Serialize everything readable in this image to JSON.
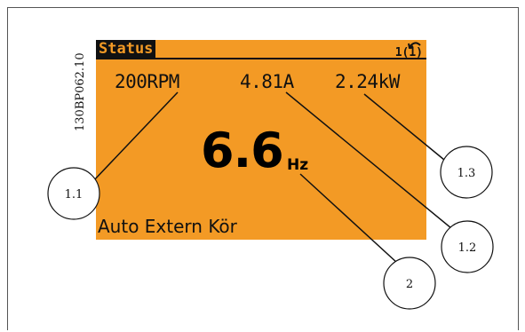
{
  "display": {
    "status_label": "Status",
    "menu_number": "1(1)",
    "speed": "200RPM",
    "current": "4.81A",
    "power": "2.24kW",
    "frequency_value": "6.6",
    "frequency_unit": "Hz",
    "mode_text": "Auto Extern Kör"
  },
  "figure_code": "130BP062.10",
  "callouts": {
    "c11": "1.1",
    "c12": "1.2",
    "c13": "1.3",
    "c2": "2"
  },
  "colors": {
    "lcd_background": "#f39a25",
    "lcd_text": "#111111"
  }
}
